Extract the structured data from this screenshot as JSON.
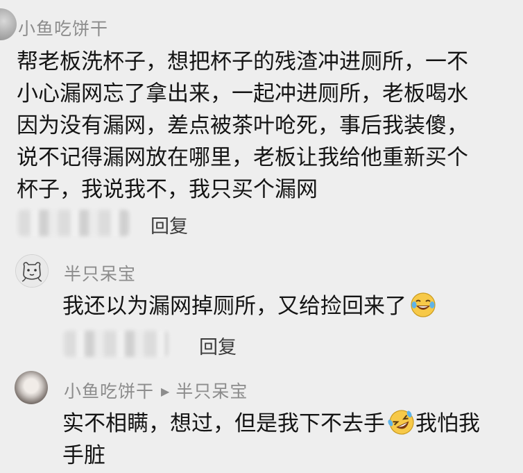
{
  "comments": [
    {
      "username": "小鱼吃饼干",
      "lines": [
        "帮老板洗杯子，想把杯子的残渣冲进厕所，一不",
        "小心漏网忘了拿出来，一起冲进厕所，老板喝水",
        "因为没有漏网，差点被茶叶呛死，事后我装傻，",
        "说不记得漏网放在哪里，老板让我给他重新买个",
        "杯子，我说我不，我只买个漏网"
      ],
      "reply_label": "回复"
    },
    {
      "username": "半只呆宝",
      "text": "我还以为漏网掉厕所，又给捡回来了",
      "emoji": "tears-of-joy-icon",
      "reply_label": "回复"
    },
    {
      "username": "小鱼吃饼干",
      "reply_to": "半只呆宝",
      "line1_before": "实不相瞒，想过，但是我下不去手",
      "line1_after": "我怕我",
      "line2": "手脏",
      "emoji": "rolling-laughing-icon"
    }
  ],
  "colors": {
    "background": "#eeeeee",
    "username": "#8c8c8c",
    "text": "#141414",
    "emoji_face": "#f7c948"
  }
}
